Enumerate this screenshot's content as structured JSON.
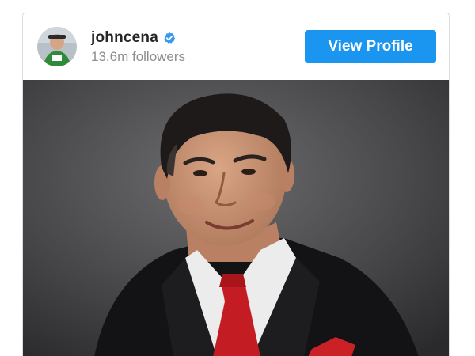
{
  "post": {
    "header": {
      "username": "johncena",
      "followers": "13.6m followers",
      "view_profile_label": "View Profile",
      "verified": true
    },
    "image": {
      "description_icon": "portrait-photo"
    }
  },
  "colors": {
    "button_bg": "#1a95f0",
    "verified_badge": "#3897f0",
    "username_text": "#262626",
    "secondary_text": "#8e8e8e",
    "border": "#dbdbdb"
  }
}
